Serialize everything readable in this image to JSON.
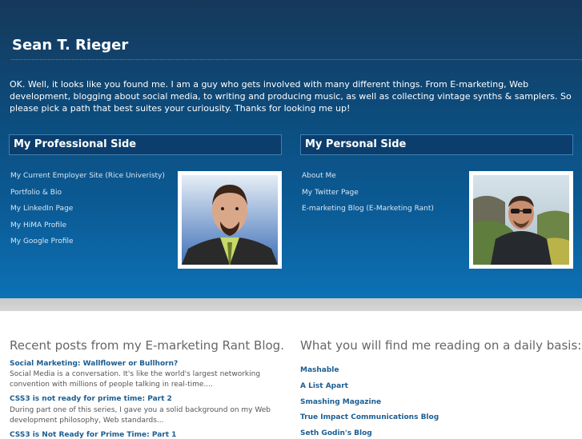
{
  "site": {
    "title": "Sean T. Rieger"
  },
  "intro": "OK. Well, it looks like you found me. I am a guy who gets involved with many different things. From E-marketing, Web development, blogging about social media, to writing and producing music, as well as collecting vintage synths & samplers. So please pick a path that best suites your curiousity. Thanks for looking me up!",
  "professional": {
    "heading": "My Professional Side",
    "links": [
      "My Current Employer Site (Rice Univeristy)",
      "Portfolio & Bio",
      "My LinkedIn Page",
      "My HiMA Profile",
      "My Google Profile"
    ]
  },
  "personal": {
    "heading": "My Personal Side",
    "links": [
      "About Me",
      "My Twitter Page",
      "E-marketing Blog (E-Marketing Rant)"
    ]
  },
  "blog": {
    "heading": "Recent posts from my E-marketing Rant Blog.",
    "posts": [
      {
        "title": "Social Marketing: Wallflower or Bullhorn?",
        "excerpt": "Social Media is a conversation.  It's like the world's largest networking convention with millions of people talking in real-time...."
      },
      {
        "title": "CSS3 is not ready for prime time: Part 2",
        "excerpt": "During part one of this series, I gave you a solid background on my Web development philosophy, Web standards..."
      },
      {
        "title": "CSS3 is Not Ready for Prime Time: Part 1",
        "excerpt": ""
      }
    ]
  },
  "reading": {
    "heading": "What you will find me reading on a daily basis:",
    "links": [
      "Mashable",
      "A List Apart",
      "Smashing Magazine",
      "True Impact Communications Blog",
      "Seth Godin's Blog"
    ]
  }
}
